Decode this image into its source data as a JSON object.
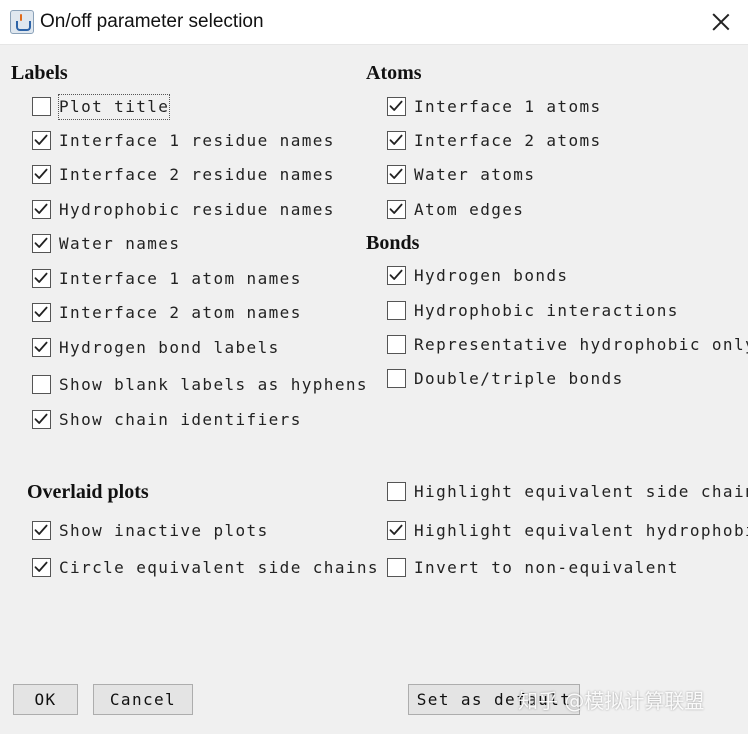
{
  "window": {
    "title": "On/off parameter selection",
    "app_icon": "java-cup-icon",
    "close_icon": "close-icon"
  },
  "labels": {
    "heading": "Labels",
    "options": [
      {
        "label": "Plot title",
        "checked": false
      },
      {
        "label": "Interface 1 residue names",
        "checked": true
      },
      {
        "label": "Interface 2 residue names",
        "checked": true
      },
      {
        "label": "Hydrophobic residue names",
        "checked": true
      },
      {
        "label": "Water names",
        "checked": true
      },
      {
        "label": "Interface 1 atom names",
        "checked": true
      },
      {
        "label": "Interface 2 atom names",
        "checked": true
      },
      {
        "label": "Hydrogen bond labels",
        "checked": true
      },
      {
        "label": "Show blank labels as hyphens",
        "checked": false
      },
      {
        "label": "Show chain identifiers",
        "checked": true
      }
    ]
  },
  "atoms": {
    "heading": "Atoms",
    "options": [
      {
        "label": "Interface 1 atoms",
        "checked": true
      },
      {
        "label": "Interface 2 atoms",
        "checked": true
      },
      {
        "label": "Water atoms",
        "checked": true
      },
      {
        "label": "Atom edges",
        "checked": true
      }
    ]
  },
  "bonds": {
    "heading": "Bonds",
    "options": [
      {
        "label": "Hydrogen bonds",
        "checked": true
      },
      {
        "label": "Hydrophobic interactions",
        "checked": false
      },
      {
        "label": "Representative hydrophobic only",
        "checked": false
      },
      {
        "label": "Double/triple bonds",
        "checked": false
      }
    ]
  },
  "overlaid": {
    "heading": "Overlaid plots",
    "left_options": [
      {
        "label": "Show inactive plots",
        "checked": true
      },
      {
        "label": "Circle equivalent side chains",
        "checked": true
      }
    ],
    "right_options": [
      {
        "label": "Highlight equivalent side chains",
        "checked": false
      },
      {
        "label": "Highlight equivalent hydrophobics",
        "checked": true
      },
      {
        "label": "Invert to non-equivalent",
        "checked": false
      }
    ]
  },
  "buttons": {
    "ok": "OK",
    "cancel": "Cancel",
    "set_default": "Set as default"
  },
  "watermark": "知乎 @模拟计算联盟",
  "colors": {
    "background": "#f0f0f0",
    "titlebar": "#ffffff",
    "checkbox_border": "#555555"
  }
}
